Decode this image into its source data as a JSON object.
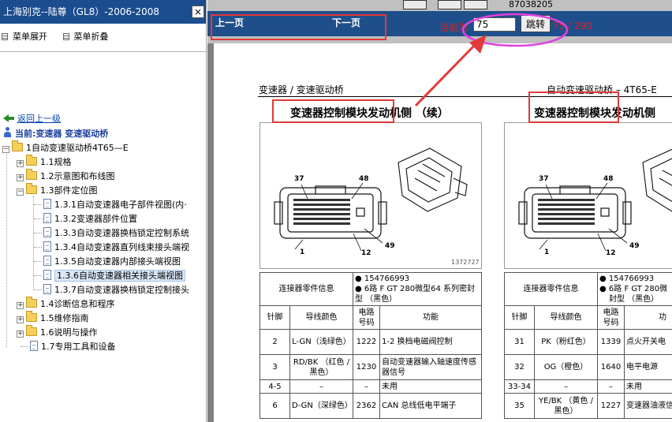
{
  "sidebar": {
    "title": "上海别克--陆尊（GL8）-2006-2008",
    "close_glyph": "×",
    "expand_label": "菜单展开",
    "collapse_label": "菜单折叠",
    "back_label": "返回上一级",
    "current_label": "当前:变速器 变速驱动桥",
    "root_label": "1自动变速驱动桥4T65—E",
    "items": [
      {
        "label": "1.1规格",
        "expanded": false
      },
      {
        "label": "1.2示意图和布线图",
        "expanded": false
      },
      {
        "label": "1.3部件定位图",
        "expanded": true
      },
      {
        "label": "1.3.1自动变速器电子部件视图(内·"
      },
      {
        "label": "1.3.2变速器部件位置"
      },
      {
        "label": "1.3.3自动变速器换档锁定控制系统"
      },
      {
        "label": "1.3.4自动变速器直列线束接头端视"
      },
      {
        "label": "1.3.5自动变速器内部接头端视图"
      },
      {
        "label": "1.3.6自动变速器相关接头端视图",
        "selected": true
      },
      {
        "label": "1.3.7自动变速器换档锁定控制接头"
      },
      {
        "label": "1.4诊断信息和程序",
        "expanded": false
      },
      {
        "label": "1.5维修指南",
        "expanded": false
      },
      {
        "label": "1.6说明与操作",
        "expanded": false
      },
      {
        "label": "1.7专用工具和设备"
      }
    ]
  },
  "viewer": {
    "prev_label": "上一页",
    "next_label": "下一页",
    "current_page_label": "当前为",
    "page_input_value": "75",
    "jump_label": "跳转",
    "page_count": "75 / 290",
    "top_code": "87038205"
  },
  "document": {
    "header_left": "变速器 / 变速驱动桥",
    "header_right": "自动变速驱动桥 – 4T65-E",
    "left_title": "变速器控制模块发动机侧 （续）",
    "right_title": "变速器控制模块发动机侧",
    "left_diagram": {
      "pins": [
        "37",
        "48",
        "1",
        "12",
        "49"
      ],
      "image_id": "1372727"
    },
    "right_diagram": {
      "pins": [
        "37",
        "48",
        "1",
        "12",
        "49"
      ]
    },
    "left_table": {
      "connector_info_label": "连接器零件信息",
      "connector_info_1": "154766993",
      "connector_info_2": "6路 F GT 280微型64 系列密封型 （黑色）",
      "headers": [
        "针脚",
        "导线颜色",
        "电路号码",
        "功能"
      ],
      "rows": [
        [
          "2",
          "L-GN（浅绿色）",
          "1222",
          "1-2 换档电磁阀控制"
        ],
        [
          "3",
          "RD/BK （红色 / 黑色）",
          "1230",
          "自动变速器输入轴速度传感器信号"
        ],
        [
          "4-5",
          "–",
          "–",
          "未用"
        ],
        [
          "6",
          "D-GN（深绿色）",
          "2362",
          "CAN 总线低电平端子"
        ]
      ]
    },
    "right_table": {
      "connector_info_label": "连接器零件信息",
      "connector_info_1": "154766993",
      "connector_info_2": "6路 F GT 280微",
      "connector_info_3": "封型 （黑色）",
      "headers": [
        "针脚",
        "导线颜色",
        "电路号码",
        "功"
      ],
      "rows": [
        [
          "31",
          "PK（粉红色）",
          "1339",
          "点火开关电"
        ],
        [
          "32",
          "OG（橙色）",
          "1640",
          "电平电源"
        ],
        [
          "33-34",
          "–",
          "–",
          "未用"
        ],
        [
          "35",
          "YE/BK （黄色 / 黑色）",
          "1227",
          "变速器油液信号"
        ]
      ]
    }
  },
  "colors": {
    "sidebar_title_bg": "#1b4d8f",
    "nav_strip_bg": "#1e4f8a",
    "highlight_red": "#e23a3a",
    "annotation_magenta": "#e040e0",
    "page_number_red": "#d22222"
  },
  "icons": [
    "close-icon",
    "menu-expand-icon",
    "menu-collapse-icon",
    "back-arrow-icon",
    "current-location-icon",
    "folder-icon",
    "document-icon",
    "plus-icon",
    "minus-icon",
    "arrow-annotation-icon"
  ]
}
